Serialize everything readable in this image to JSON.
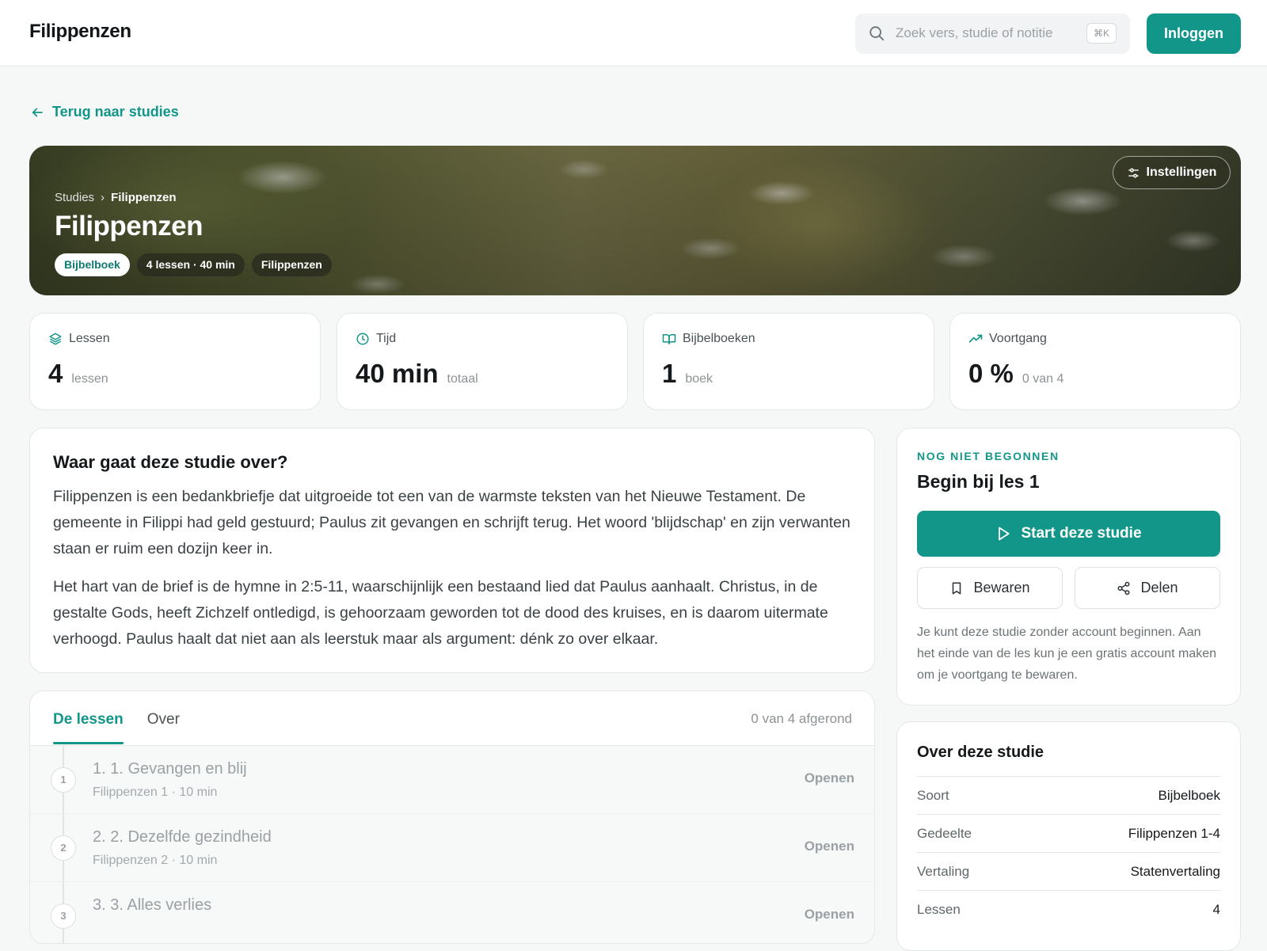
{
  "header": {
    "brand": "Filippenzen",
    "search_placeholder": "Zoek vers, studie of notitie",
    "search_shortcut": "⌘K",
    "login_label": "Inloggen"
  },
  "back_link": {
    "label": "Terug naar studies"
  },
  "hero": {
    "breadcrumb": [
      "Studies",
      "Filippenzen"
    ],
    "breadcrumb_separator": "›",
    "title": "Filippenzen",
    "chips": [
      "Bijbelboek",
      "4 lessen · 40 min",
      "Filippenzen"
    ],
    "settings_label": "Instellingen"
  },
  "stats": [
    {
      "label": "Lessen",
      "value": "4",
      "unit": "lessen",
      "icon": "layers-icon"
    },
    {
      "label": "Tijd",
      "value": "40 min",
      "unit": "totaal",
      "icon": "clock-icon"
    },
    {
      "label": "Bijbelboeken",
      "value": "1",
      "unit": "boek",
      "icon": "book-open-icon"
    },
    {
      "label": "Voortgang",
      "value": "0 %",
      "unit": "0 van 4",
      "icon": "trending-up-icon"
    }
  ],
  "about": {
    "heading": "Waar gaat deze studie over?",
    "paragraphs": [
      "Filippenzen is een bedankbriefje dat uitgroeide tot een van de warmste teksten van het Nieuwe Testament. De gemeente in Filippi had geld gestuurd; Paulus zit gevangen en schrijft terug. Het woord 'blijdschap' en zijn verwanten staan er ruim een dozijn keer in.",
      "Het hart van de brief is de hymne in 2:5-11, waarschijnlijk een bestaand lied dat Paulus aanhaalt. Christus, in de gestalte Gods, heeft Zichzelf ontledigd, is gehoorzaam geworden tot de dood des kruises, en is daarom uitermate verhoogd. Paulus haalt dat niet aan als leerstuk maar als argument: dénk zo over elkaar."
    ]
  },
  "lessons_panel": {
    "tabs": [
      "De lessen",
      "Over"
    ],
    "active_tab": "De lessen",
    "progress_text": "0 van 4 afgerond",
    "open_label": "Openen",
    "lessons": [
      {
        "num": "1",
        "title": "1. 1. Gevangen en blij",
        "meta": "Filippenzen 1 · 10 min"
      },
      {
        "num": "2",
        "title": "2. 2. Dezelfde gezindheid",
        "meta": "Filippenzen 2 · 10 min"
      },
      {
        "num": "3",
        "title": "3. 3. Alles verlies",
        "meta": ""
      }
    ]
  },
  "start_card": {
    "eyebrow": "NOG NIET BEGONNEN",
    "title": "Begin bij les 1",
    "start_label": "Start deze studie",
    "save_label": "Bewaren",
    "share_label": "Delen",
    "note": "Je kunt deze studie zonder account beginnen. Aan het einde van de les kun je een gratis account maken om je voortgang te bewaren."
  },
  "info_card": {
    "heading": "Over deze studie",
    "rows": [
      {
        "key": "Soort",
        "value": "Bijbelboek"
      },
      {
        "key": "Gedeelte",
        "value": "Filippenzen 1-4"
      },
      {
        "key": "Vertaling",
        "value": "Statenvertaling"
      },
      {
        "key": "Lessen",
        "value": "4"
      }
    ]
  },
  "colors": {
    "accent": "#13968a",
    "background": "#f6f7f7",
    "card": "#ffffff"
  }
}
